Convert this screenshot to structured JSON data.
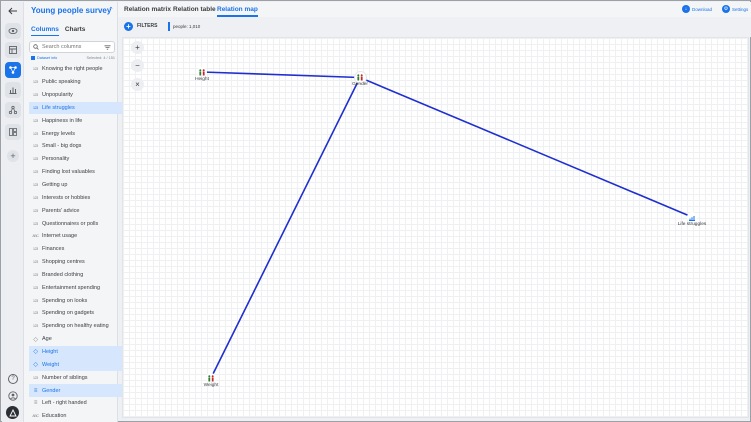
{
  "app": {
    "survey_title": "Young people survey"
  },
  "rail": {
    "items": [
      {
        "icon": "back-arrow-icon",
        "glyph": "←"
      },
      {
        "icon": "eye-icon"
      },
      {
        "icon": "table-icon"
      },
      {
        "icon": "relation-map-icon"
      },
      {
        "icon": "bar-chart-icon"
      },
      {
        "icon": "network-icon"
      },
      {
        "icon": "layout-icon"
      },
      {
        "icon": "add-icon",
        "glyph": "+"
      },
      {
        "icon": "help-icon",
        "glyph": "?"
      },
      {
        "icon": "user-icon"
      },
      {
        "icon": "logo-icon"
      }
    ]
  },
  "sidebar": {
    "tabs": [
      "Columns",
      "Charts"
    ],
    "search_placeholder": "Search columns",
    "dataset_info": "Dataset info",
    "selected_label": "Selected: 4 / 151",
    "columns": [
      {
        "label": "Knowing the right people",
        "type": "123",
        "highlight": false
      },
      {
        "label": "Public speaking",
        "type": "123",
        "highlight": false
      },
      {
        "label": "Unpopularity",
        "type": "123",
        "highlight": false
      },
      {
        "label": "Life struggles",
        "type": "123",
        "highlight": true
      },
      {
        "label": "Happiness in life",
        "type": "123",
        "highlight": false
      },
      {
        "label": "Energy levels",
        "type": "123",
        "highlight": false
      },
      {
        "label": "Small - big dogs",
        "type": "123",
        "highlight": false
      },
      {
        "label": "Personality",
        "type": "123",
        "highlight": false
      },
      {
        "label": "Finding lost valuables",
        "type": "123",
        "highlight": false
      },
      {
        "label": "Getting up",
        "type": "123",
        "highlight": false
      },
      {
        "label": "Interests or hobbies",
        "type": "123",
        "highlight": false
      },
      {
        "label": "Parents' advice",
        "type": "123",
        "highlight": false
      },
      {
        "label": "Questionnaires or polls",
        "type": "123",
        "highlight": false
      },
      {
        "label": "Internet usage",
        "type": "ABC",
        "highlight": false
      },
      {
        "label": "Finances",
        "type": "123",
        "highlight": false
      },
      {
        "label": "Shopping centres",
        "type": "123",
        "highlight": false
      },
      {
        "label": "Branded clothing",
        "type": "123",
        "highlight": false
      },
      {
        "label": "Entertainment spending",
        "type": "123",
        "highlight": false
      },
      {
        "label": "Spending on looks",
        "type": "123",
        "highlight": false
      },
      {
        "label": "Spending on gadgets",
        "type": "123",
        "highlight": false
      },
      {
        "label": "Spending on healthy eating",
        "type": "123",
        "highlight": false
      },
      {
        "label": "Age",
        "type": "tag",
        "highlight": false
      },
      {
        "label": "Height",
        "type": "tag",
        "highlight": true
      },
      {
        "label": "Weight",
        "type": "tag",
        "highlight": true
      },
      {
        "label": "Number of siblings",
        "type": "123",
        "highlight": false
      },
      {
        "label": "Gender",
        "type": "cat",
        "highlight": true
      },
      {
        "label": "Left - right handed",
        "type": "cat",
        "highlight": false
      },
      {
        "label": "Education",
        "type": "ABC",
        "highlight": false
      }
    ]
  },
  "topbar": {
    "tabs": [
      "Relation matrix",
      "Relation table",
      "Relation map"
    ],
    "active_tab": "Relation map",
    "download_label": "Download",
    "settings_label": "Settings"
  },
  "filters": {
    "label": "FILTERS",
    "chip": "people: 1,010"
  },
  "map": {
    "zoom_in": "+",
    "zoom_out": "−",
    "reset": "×",
    "edge_color": "#1f2fcf",
    "nodes": [
      {
        "id": "height",
        "label": "Height",
        "icon": "people-icon"
      },
      {
        "id": "gender",
        "label": "Gender",
        "icon": "people-icon"
      },
      {
        "id": "life",
        "label": "Life struggles",
        "icon": "bars-icon"
      },
      {
        "id": "weight",
        "label": "Weight",
        "icon": "people-icon"
      }
    ],
    "edges": [
      {
        "from": "height",
        "to": "gender"
      },
      {
        "from": "gender",
        "to": "life"
      },
      {
        "from": "gender",
        "to": "weight"
      }
    ]
  },
  "colors": {
    "accent": "#1a73e8",
    "highlight_bg": "#d6e7fd"
  }
}
